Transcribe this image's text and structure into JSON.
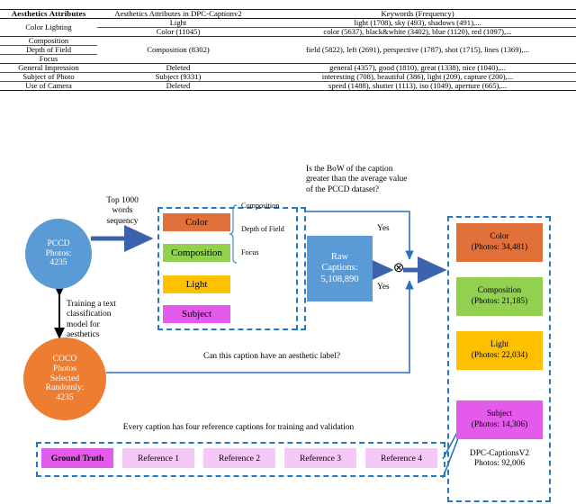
{
  "table": {
    "headers": [
      "Aesthetics Attributes",
      "Aesthetics Attributes in DPC-Captionv2",
      "Keywords (Frequency)"
    ],
    "rows": [
      {
        "attribute": "Color Lighting",
        "sub": [
          {
            "mapped": "Light",
            "keywords": "light (1708), sky (493), shadows (491),..."
          },
          {
            "mapped": "Color (11045)",
            "keywords": "color (5637), black&white (3402), blue (1120), red (1097),..."
          }
        ]
      },
      {
        "attributes": [
          "Composition",
          "Depth of Field",
          "Focus"
        ],
        "mapped": "Composition (8302)",
        "keywords": "field (5822), left (2691), perspective (1787), shot (1715), lines (1369),..."
      },
      {
        "attribute": "General Impression",
        "mapped": "Deleted",
        "keywords": "general (4357), good (1810), great (1338), nice (1040),..."
      },
      {
        "attribute": "Subject of Photo",
        "mapped": "Subject (9331)",
        "keywords": "interesting (708), beautiful (386), light (209), capture (200),..."
      },
      {
        "attribute": "Use of Camera",
        "mapped": "Deleted",
        "keywords": "speed (1488), shutter (1113), iso (1049), aperture (665),..."
      }
    ]
  },
  "diagram": {
    "pccd_node": "PCCD\nPhotos:\n4235",
    "pccd_lines": [
      "PCCD",
      "Photos:",
      "4235"
    ],
    "coco_lines": [
      "COCO",
      "Photos",
      "Selected",
      "Randomly:",
      "4235"
    ],
    "top_arrow_label": "Top 1000\nwords\nsequency",
    "top_arrow_lines": [
      "Top 1000",
      "words",
      "sequency"
    ],
    "training_label": "Training a text classification model for aesthetics",
    "training_lines": [
      "Training a text",
      "classification",
      "model for",
      "aesthetics"
    ],
    "attribute_chips": [
      {
        "label": "Color",
        "color": "#e2703a"
      },
      {
        "label": "Composition",
        "color": "#92d050"
      },
      {
        "label": "Light",
        "color": "#ffc000"
      },
      {
        "label": "Subject",
        "color": "#e45bec"
      }
    ],
    "bracket_items": [
      "Composition",
      "Depth of Field",
      "Focus"
    ],
    "question_bow_lines": [
      "Is the BoW of the caption",
      "greater than the average value",
      "of the PCCD dataset?"
    ],
    "raw_captions_lines": [
      "Raw",
      "Captions:",
      "5,108,890"
    ],
    "yes_top": "Yes",
    "yes_bottom": "Yes",
    "question_aesthetic": "Can this caption have an aesthetic label?",
    "reference_note": "Every caption has four reference captions for training and validation",
    "reference_chips": [
      "Ground Truth",
      "Reference 1",
      "Reference 2",
      "Reference 3",
      "Reference 4"
    ],
    "output_chips": [
      {
        "title": "Color",
        "count": "(Photos: 34,481)",
        "color": "#e2703a"
      },
      {
        "title": "Composition",
        "count": "(Photos: 21,185)",
        "color": "#92d050"
      },
      {
        "title": "Light",
        "count": "(Photos: 22,034)",
        "color": "#ffc000"
      },
      {
        "title": "Subject",
        "count": "(Photos: 14,306)",
        "color": "#e45bec"
      }
    ],
    "output_footer_lines": [
      "DPC-CaptionsV2",
      "Photos: 92,006"
    ],
    "xor_symbol": "⊗",
    "colors": {
      "dashed_border": "#1f78c8",
      "arrow_blue": "#3a63ab",
      "line_blue": "#2e6fbf",
      "pccd_fill": "#5b9bd5",
      "coco_fill": "#ed7d31"
    }
  }
}
